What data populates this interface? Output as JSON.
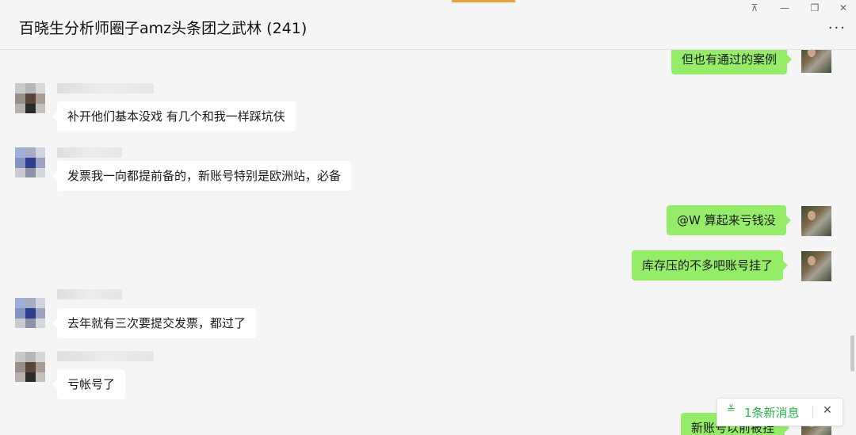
{
  "window": {
    "title": "百晓生分析师圈子amz头条团之武林 (241)",
    "more": "...",
    "controls": {
      "pin": "⊼",
      "minimize": "—",
      "restore": "❐",
      "close": "✕"
    }
  },
  "messages": [
    {
      "side": "right",
      "text": "但也有通过的案例"
    },
    {
      "side": "left",
      "text": "补开他们基本没戏  有几个和我一样踩坑伕",
      "avatar": "brown"
    },
    {
      "side": "left",
      "text": "发票我一向都提前备的，新账号特别是欧洲站，必备",
      "avatar": "blue"
    },
    {
      "side": "right",
      "text": "@W 算起来亏钱没"
    },
    {
      "side": "right",
      "text": "库存压的不多吧账号挂了"
    },
    {
      "side": "left",
      "text": "去年就有三次要提交发票，都过了",
      "avatar": "blue"
    },
    {
      "side": "left",
      "text": "亏帐号了",
      "avatar": "brown"
    },
    {
      "side": "right",
      "text": "新账号以前被挂"
    }
  ],
  "new_message_tip": {
    "arrow": "≚",
    "label": "1条新消息",
    "close": "✕"
  },
  "colors": {
    "self_bubble": "#95ec69",
    "other_bubble": "#ffffff",
    "background": "#f5f5f5",
    "accent_green": "#29b34b"
  }
}
